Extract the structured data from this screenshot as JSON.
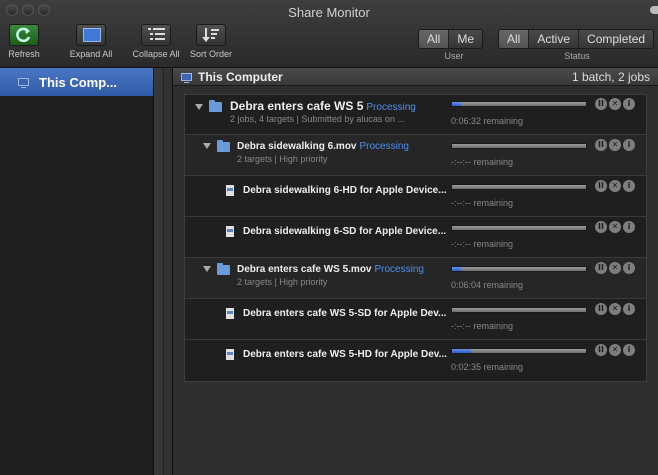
{
  "window": {
    "title": "Share Monitor"
  },
  "toolbar": {
    "refresh_label": "Refresh",
    "expand_label": "Expand All",
    "collapse_label": "Collapse All",
    "sort_label": "Sort Order",
    "user_caption": "User",
    "user_options": [
      "All",
      "Me"
    ],
    "user_selected": "All",
    "status_caption": "Status",
    "status_options": [
      "All",
      "Active",
      "Completed"
    ],
    "status_selected": "All"
  },
  "sidebar": {
    "items": [
      {
        "label": "This Comp...",
        "icon": "computer-icon"
      }
    ]
  },
  "main": {
    "header": {
      "title": "This Computer",
      "count": "1 batch, 2 jobs"
    },
    "rows": [
      {
        "name": "Debra enters cafe WS 5",
        "status": "Processing",
        "sub": "2 jobs, 4 targets  |  Submitted by alucas on ...",
        "remaining": "0:06:32 remaining",
        "progress": 0.07
      },
      {
        "name": "Debra sidewalking 6.mov",
        "status": "Processing",
        "sub": "2 targets  |  High priority",
        "remaining": "-:--:-- remaining",
        "progress": 0
      },
      {
        "name": "Debra sidewalking 6-HD for Apple Device...",
        "remaining": "-:--:-- remaining",
        "progress": 0
      },
      {
        "name": "Debra sidewalking 6-SD for Apple Device...",
        "remaining": "-:--:-- remaining",
        "progress": 0
      },
      {
        "name": "Debra enters cafe WS 5.mov",
        "status": "Processing",
        "sub": "2 targets  |  High priority",
        "remaining": "0:06:04 remaining",
        "progress": 0.07
      },
      {
        "name": "Debra enters cafe WS 5-SD for Apple Dev...",
        "remaining": "-:--:-- remaining",
        "progress": 0
      },
      {
        "name": "Debra enters cafe WS 5-HD for Apple Dev...",
        "remaining": "0:02:35 remaining",
        "progress": 0.14
      }
    ],
    "controls": {
      "pause": "II",
      "cancel": "✕",
      "info": "i"
    }
  }
}
